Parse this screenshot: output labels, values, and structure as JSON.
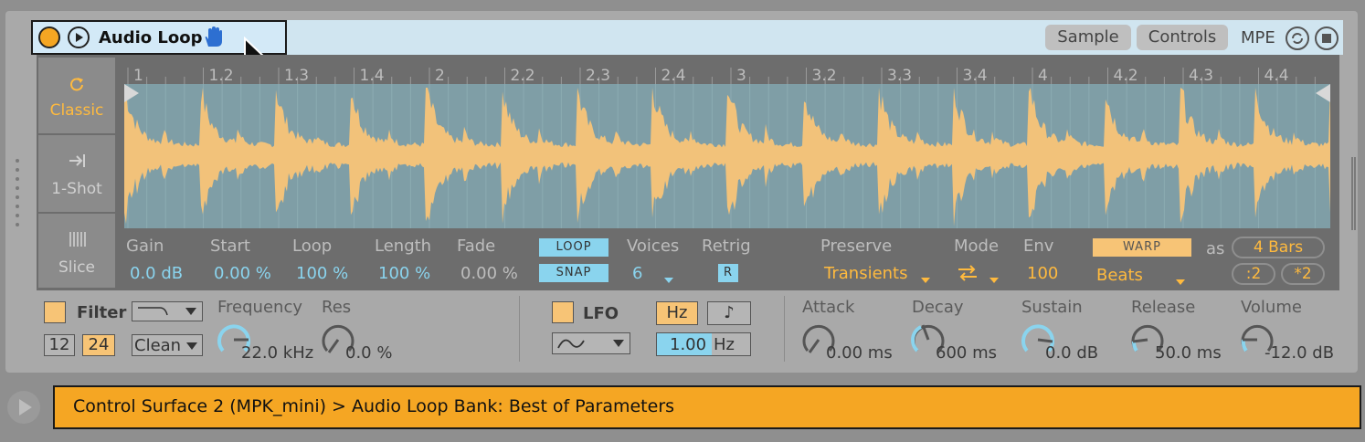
{
  "device": {
    "title": "Audio Loop",
    "tabs": [
      "Sample",
      "Controls"
    ],
    "mpe_label": "MPE"
  },
  "modes": [
    {
      "label": "Classic",
      "icon": "loop-icon",
      "active": true
    },
    {
      "label": "1-Shot",
      "icon": "arrow-right-bar-icon",
      "active": false
    },
    {
      "label": "Slice",
      "icon": "slice-bars-icon",
      "active": false
    }
  ],
  "ruler": {
    "marks": [
      "1",
      "1.2",
      "1.3",
      "1.4",
      "2",
      "2.2",
      "2.3",
      "2.4",
      "3",
      "3.2",
      "3.3",
      "3.4",
      "4",
      "4.2",
      "4.3",
      "4.4"
    ]
  },
  "params": {
    "gain": {
      "label": "Gain",
      "value": "0.0 dB"
    },
    "start": {
      "label": "Start",
      "value": "0.00 %"
    },
    "loop": {
      "label": "Loop",
      "value": "100 %"
    },
    "length": {
      "label": "Length",
      "value": "100 %"
    },
    "fade": {
      "label": "Fade",
      "value": "0.00 %"
    },
    "loop_btn": "LOOP",
    "snap_btn": "SNAP",
    "voices": {
      "label": "Voices",
      "value": "6"
    },
    "retrig": {
      "label": "Retrig",
      "value": "R"
    },
    "preserve": {
      "label": "Preserve",
      "value": "Transients"
    },
    "mode": {
      "label": "Mode"
    },
    "env": {
      "label": "Env",
      "value": "100"
    },
    "warp_btn": "WARP",
    "warp_mode": "Beats",
    "as_label": "as",
    "bars": "4 Bars",
    "half": ":2",
    "double": "*2"
  },
  "filter": {
    "label": "Filter",
    "slope_12": "12",
    "slope_24": "24",
    "circuit": "Clean",
    "frequency": {
      "label": "Frequency",
      "value": "22.0 kHz"
    },
    "res": {
      "label": "Res",
      "value": "0.0 %"
    }
  },
  "lfo": {
    "label": "LFO",
    "hz_btn": "Hz",
    "note_btn": "♪",
    "rate_value": "1.00",
    "rate_unit": "Hz"
  },
  "envelope": {
    "attack": {
      "label": "Attack",
      "value": "0.00 ms"
    },
    "decay": {
      "label": "Decay",
      "value": "600 ms"
    },
    "sustain": {
      "label": "Sustain",
      "value": "0.0 dB"
    },
    "release": {
      "label": "Release",
      "value": "50.0 ms"
    },
    "volume": {
      "label": "Volume",
      "value": "-12.0 dB"
    }
  },
  "status_bar": {
    "text": "Control Surface 2 (MPK_mini) > Audio Loop Bank: Best of Parameters"
  },
  "colors": {
    "accent_orange": "#f5a623",
    "value_blue": "#8ad4ee",
    "wave_fill": "#f2c27a",
    "wave_bg": "#7f9ea6"
  }
}
